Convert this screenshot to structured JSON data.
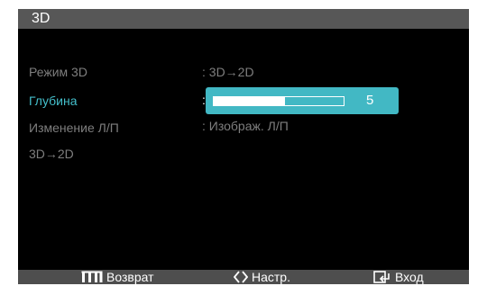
{
  "window": {
    "title": "3D"
  },
  "menu": {
    "items": [
      {
        "label": "Режим 3D",
        "value": ": 3D→2D"
      },
      {
        "label": "Глубина",
        "value": ""
      },
      {
        "label": "Изменение Л/П",
        "value": ": Изображ. Л/П"
      },
      {
        "label": "3D→2D",
        "value": ""
      }
    ],
    "selected_index": 1
  },
  "depth_slider": {
    "colon": ":",
    "value": "5",
    "fill_fraction": 0.55
  },
  "footer": {
    "back_label": "Возврат",
    "adjust_label": "Настр.",
    "enter_label": "Вход",
    "back_icon": "menu-bars-icon",
    "adjust_icon": "diamond-arrows-icon",
    "enter_icon": "enter-icon"
  },
  "colors": {
    "accent": "#44bfcb",
    "highlight": "#42b8c4",
    "inactive_text": "#7e7e7e",
    "title_bar": "#575757"
  }
}
